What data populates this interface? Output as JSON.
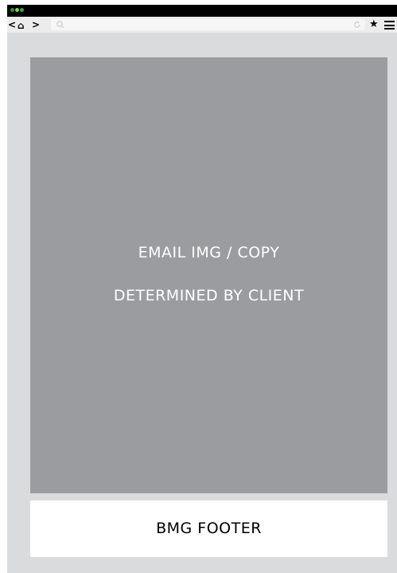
{
  "browser": {
    "traffic_lights": [
      {
        "name": "close",
        "color": "#3b8c2f"
      },
      {
        "name": "minimize",
        "color": "#8fd14f"
      },
      {
        "name": "maximize",
        "color": "#34a853"
      }
    ],
    "nav": {
      "back": "<",
      "home": "⌂",
      "forward": ">"
    },
    "address_bar": {
      "value": "",
      "search_icon": "search-icon",
      "reload_icon": "reload-icon"
    },
    "bookmark_icon": "star-icon",
    "bookmark_glyph": "★",
    "menu_icon": "hamburger-menu-icon"
  },
  "email": {
    "hero": {
      "line1": "EMAIL IMG / COPY",
      "line2": "DETERMINED BY CLIENT",
      "background": "#9b9c9f"
    },
    "footer": {
      "label": "BMG FOOTER",
      "background": "#ffffff"
    },
    "canvas_background": "#dadbdd"
  }
}
